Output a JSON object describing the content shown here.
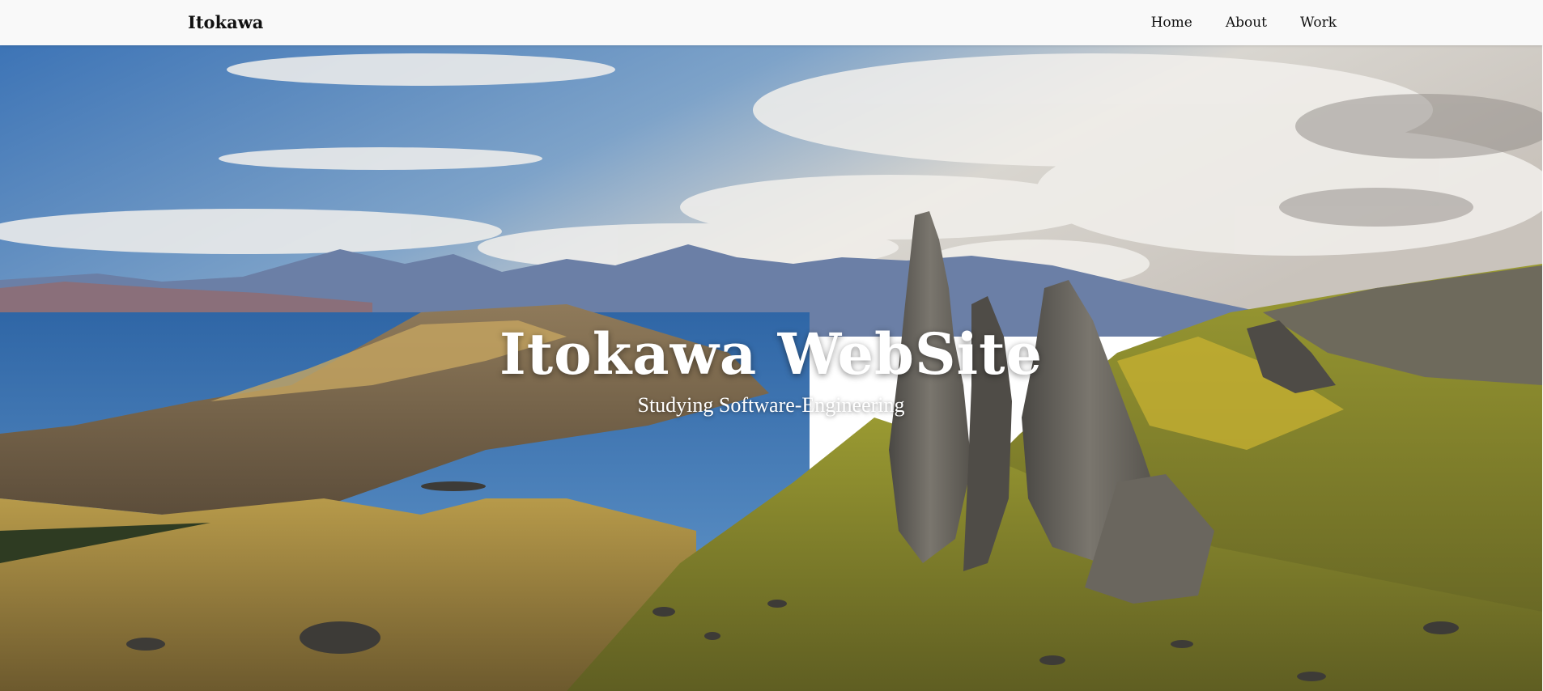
{
  "navbar": {
    "brand": "Itokawa",
    "links": [
      "Home",
      "About",
      "Work"
    ]
  },
  "hero": {
    "title": "Itokawa WebSite",
    "subtitle": "Studying Software-Engineering",
    "image_subject": "landscape-photo-rock-pinnacles-lake-mountains"
  },
  "colors": {
    "navbar_bg": "#f9f9f9",
    "text_dark": "#111111",
    "hero_text": "#ffffff",
    "sky": "#4f7fb8",
    "water": "#3f77b2",
    "grass": "#8a8a2c",
    "rock": "#5e5b55"
  }
}
